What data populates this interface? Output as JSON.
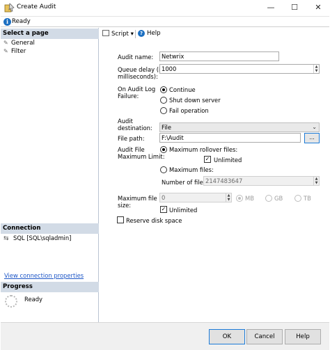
{
  "window": {
    "title": "Create Audit",
    "minimize": "—",
    "maximize": "☐",
    "close": "✕"
  },
  "status": {
    "text": "Ready",
    "icon": "info-icon"
  },
  "left_panel": {
    "select_page_header": "Select a page",
    "pages": [
      "General",
      "Filter"
    ],
    "connection_header": "Connection",
    "connection_value": "SQL [SQL\\sqladmin]",
    "view_connection_link": "View connection properties",
    "progress_header": "Progress",
    "progress_status": "Ready"
  },
  "toolbar": {
    "script_label": "Script",
    "script_dropdown": "▾",
    "help_label": "Help"
  },
  "form": {
    "audit_name_label": "Audit name:",
    "audit_name_value": "Netwrix",
    "queue_delay_label_1": "Queue delay (in",
    "queue_delay_label_2": "milliseconds):",
    "queue_delay_value": "1000",
    "on_failure_label_1": "On Audit Log",
    "on_failure_label_2": "Failure:",
    "on_failure_options": [
      "Continue",
      "Shut down server",
      "Fail operation"
    ],
    "on_failure_selected": "Continue",
    "audit_destination_label_1": "Audit",
    "audit_destination_label_2": "destination:",
    "audit_destination_value": "File",
    "file_path_label": "File path:",
    "file_path_value": "F:\\Audit",
    "browse_label": "...",
    "max_limit_label_1": "Audit File",
    "max_limit_label_2": "Maximum Limit:",
    "max_rollover_label": "Maximum rollover files:",
    "unlimited_label": "Unlimited",
    "max_files_label": "Maximum files:",
    "number_of_files_label": "Number of files:",
    "number_of_files_value": "2147483647",
    "max_file_size_label_1": "Maximum file",
    "max_file_size_label_2": "size:",
    "max_file_size_value": "0",
    "size_units": [
      "MB",
      "GB",
      "TB"
    ],
    "size_unit_selected": "MB",
    "size_unlimited_label": "Unlimited",
    "reserve_disk_label": "Reserve disk space"
  },
  "buttons": {
    "ok": "OK",
    "cancel": "Cancel",
    "help": "Help"
  }
}
